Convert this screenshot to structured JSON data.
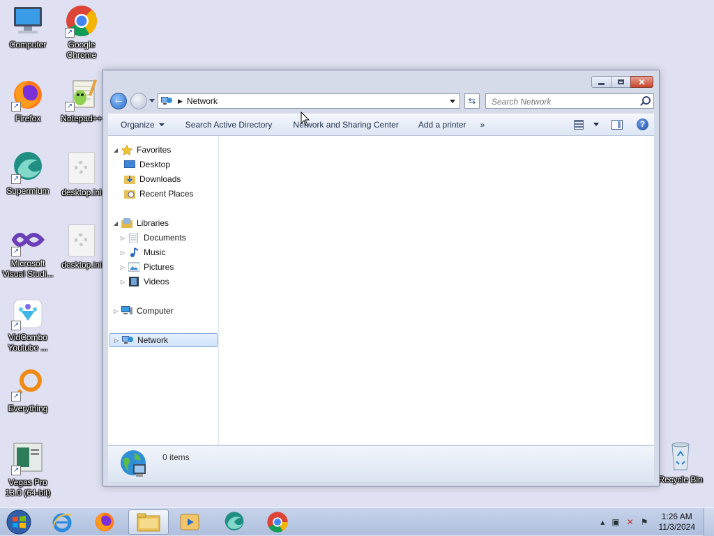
{
  "desktop": {
    "icons": [
      {
        "label": "Computer"
      },
      {
        "label": "Google Chrome"
      },
      {
        "label": "Firefox"
      },
      {
        "label": "Notepad++"
      },
      {
        "label": "Supermium"
      },
      {
        "label": "desktop.ini"
      },
      {
        "label": "Microsoft Visual Studi..."
      },
      {
        "label": "desktop.ini"
      },
      {
        "label": "VidCombo Youtube ..."
      },
      {
        "label": "Everything"
      },
      {
        "label": "Vegas Pro 13.0 (64-bit)"
      },
      {
        "label": "Recycle Bin"
      }
    ]
  },
  "window": {
    "address": {
      "crumb": "Network"
    },
    "search": {
      "placeholder": "Search Network"
    },
    "toolbar": {
      "organize": "Organize",
      "search_ad": "Search Active Directory",
      "sharing_center": "Network and Sharing Center",
      "add_printer": "Add a printer",
      "more": "»"
    },
    "nav": {
      "favorites": "Favorites",
      "desktop": "Desktop",
      "downloads": "Downloads",
      "recent": "Recent Places",
      "libraries": "Libraries",
      "documents": "Documents",
      "music": "Music",
      "pictures": "Pictures",
      "videos": "Videos",
      "computer": "Computer",
      "network": "Network"
    },
    "details": {
      "count": "0 items"
    }
  },
  "taskbar": {
    "clock_time": "1:26 AM",
    "clock_date": "11/3/2024"
  },
  "colors": {
    "desktop_bg": "#dfe1f2",
    "selection": "#cfe3fb",
    "taskbar": "#aebfdd"
  }
}
